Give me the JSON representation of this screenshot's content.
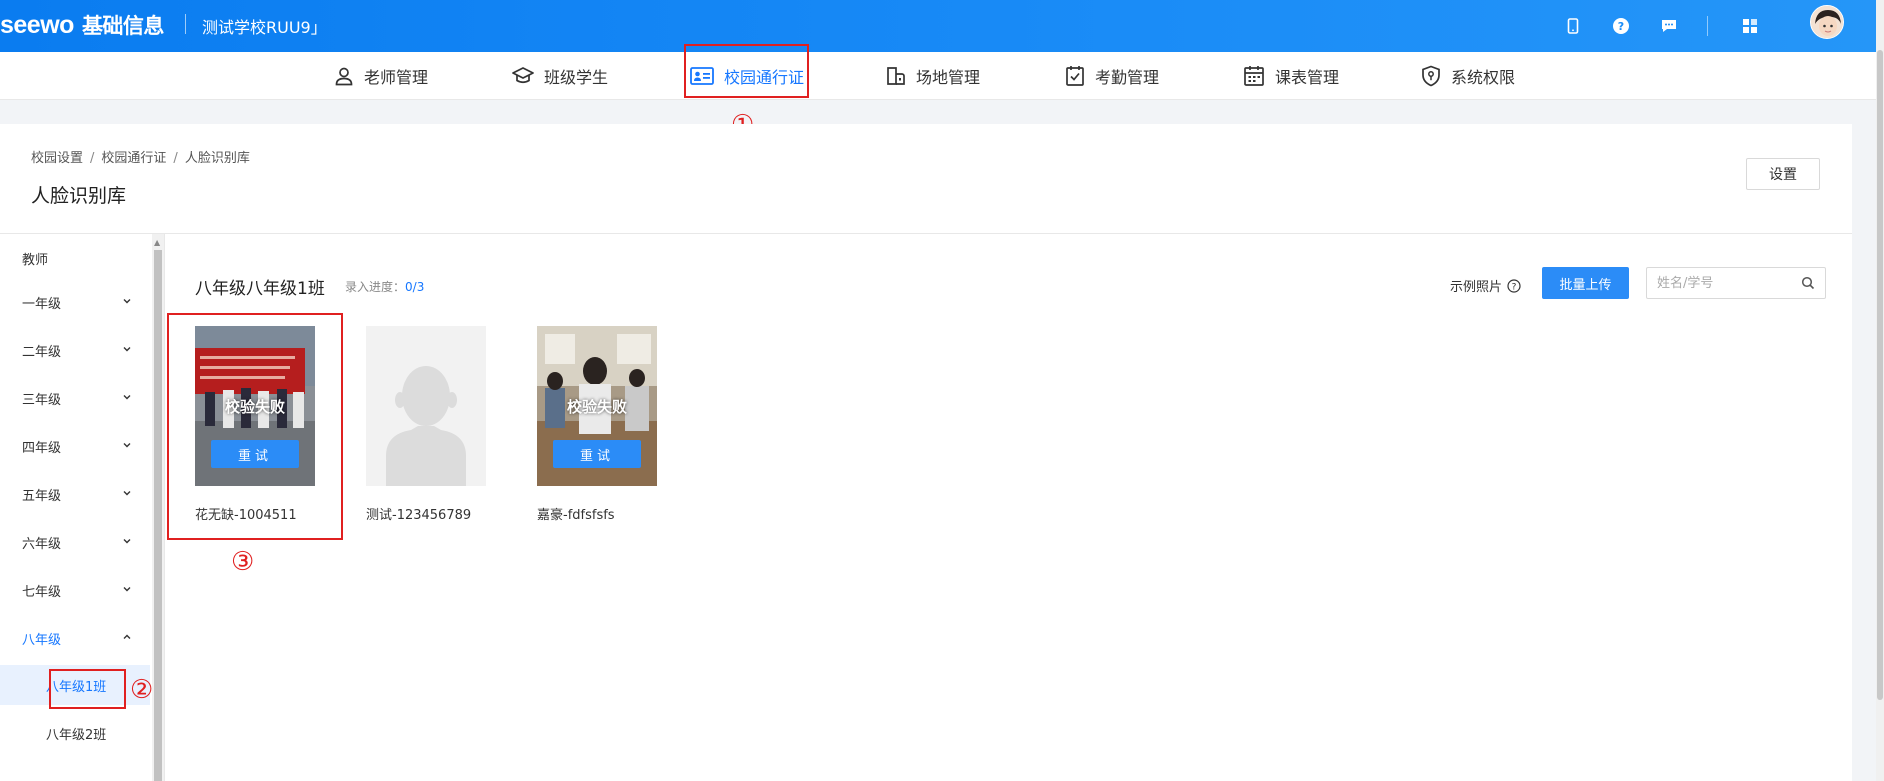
{
  "header": {
    "brand": "seewo",
    "brand_sub": "基础信息",
    "school": "测试学校RUU9」"
  },
  "nav": {
    "items": [
      {
        "label": "老师管理",
        "icon": "user-icon"
      },
      {
        "label": "班级学生",
        "icon": "graduation-cap-icon"
      },
      {
        "label": "校园通行证",
        "icon": "id-card-icon",
        "active": true
      },
      {
        "label": "场地管理",
        "icon": "building-icon"
      },
      {
        "label": "考勤管理",
        "icon": "clipboard-check-icon"
      },
      {
        "label": "课表管理",
        "icon": "calendar-icon"
      },
      {
        "label": "系统权限",
        "icon": "shield-icon"
      }
    ]
  },
  "breadcrumb": [
    "校园设置",
    "校园通行证",
    "人脸识别库"
  ],
  "page_title": "人脸识别库",
  "settings_label": "设置",
  "sidebar": {
    "teacher": "教师",
    "grades": [
      "一年级",
      "二年级",
      "三年级",
      "四年级",
      "五年级",
      "六年级",
      "七年级",
      "八年级"
    ],
    "open_grade": "八年级",
    "classes": [
      "八年级1班",
      "八年级2班"
    ],
    "selected_class": "八年级1班"
  },
  "content": {
    "class_title": "八年级八年级1班",
    "progress_label": "录入进度：",
    "progress_value": "0/3",
    "sample_label": "示例照片",
    "upload_label": "批量上传",
    "search_placeholder": "姓名/学号"
  },
  "students": [
    {
      "name": "花无缺-1004511",
      "status": "校验失败",
      "retry": "重试",
      "photo": "protest"
    },
    {
      "name": "测试-123456789",
      "status": "",
      "retry": "",
      "photo": "placeholder"
    },
    {
      "name": "嘉豪-fdfsfsfs",
      "status": "校验失败",
      "retry": "重试",
      "photo": "classroom"
    }
  ],
  "annotations": [
    "①",
    "②",
    "③"
  ],
  "colors": {
    "primary": "#1677ff",
    "button": "#2b8cf7",
    "header": "#0a7cf0",
    "annotation": "#e02020"
  }
}
